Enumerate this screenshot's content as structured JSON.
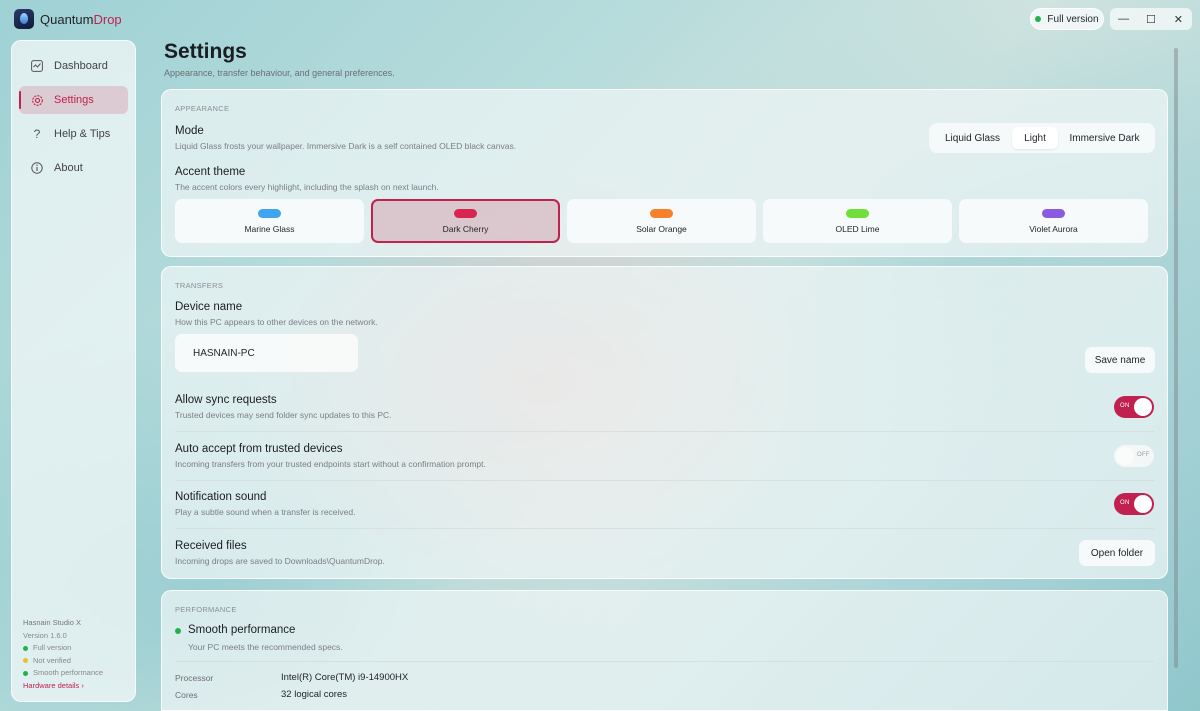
{
  "app": {
    "name_main": "Quantum",
    "name_accent": "Drop",
    "full_version_label": "Full version",
    "window_controls": {
      "minimize": "—",
      "maximize": "☐",
      "close": "✕"
    }
  },
  "sidebar": {
    "items": [
      {
        "label": "Dashboard",
        "icon": "dashboard-icon"
      },
      {
        "label": "Settings",
        "icon": "gear-icon",
        "active": true
      },
      {
        "label": "Help & Tips",
        "icon": "question-icon"
      },
      {
        "label": "About",
        "icon": "info-icon"
      }
    ],
    "footer": {
      "studio": "Hasnain Studio X",
      "version": "Version 1.6.0",
      "status": [
        {
          "label": "Full version",
          "color": "#22b24c"
        },
        {
          "label": "Not verified",
          "color": "#e8c12a"
        },
        {
          "label": "Smooth performance",
          "color": "#22b24c"
        }
      ],
      "hardware_link": "Hardware details ›"
    }
  },
  "page": {
    "title": "Settings",
    "subtitle": "Appearance, transfer behaviour, and general preferences."
  },
  "appearance": {
    "section": "APPEARANCE",
    "mode_title": "Mode",
    "mode_desc": "Liquid Glass frosts your wallpaper. Immersive Dark is a self contained OLED black canvas.",
    "mode_options": [
      "Liquid Glass",
      "Light",
      "Immersive Dark"
    ],
    "mode_selected": "Light",
    "accent_title": "Accent theme",
    "accent_desc": "The accent colors every highlight, including the splash on next launch.",
    "accents": [
      {
        "label": "Marine Glass",
        "color": "#3fa5f0"
      },
      {
        "label": "Dark Cherry",
        "color": "#d8254f",
        "active": true
      },
      {
        "label": "Solar Orange",
        "color": "#f5822a"
      },
      {
        "label": "OLED Lime",
        "color": "#6fe03a"
      },
      {
        "label": "Violet Aurora",
        "color": "#8a5ae0"
      }
    ]
  },
  "transfers": {
    "section": "TRANSFERS",
    "device_title": "Device name",
    "device_desc": "How this PC appears to other devices on the network.",
    "device_value": "HASNAIN-PC",
    "save_label": "Save name",
    "sync_title": "Allow sync requests",
    "sync_desc": "Trusted devices may send folder sync updates to this PC.",
    "sync_state": "ON",
    "auto_title": "Auto accept from trusted devices",
    "auto_desc": "Incoming transfers from your trusted endpoints start without a confirmation prompt.",
    "auto_state": "OFF",
    "notif_title": "Notification sound",
    "notif_desc": "Play a subtle sound when a transfer is received.",
    "notif_state": "ON",
    "received_title": "Received files",
    "received_desc": "Incoming drops are saved to Downloads\\QuantumDrop.",
    "open_folder_label": "Open folder"
  },
  "performance": {
    "section": "PERFORMANCE",
    "status_title": "Smooth performance",
    "status_desc": "Your PC meets the recommended specs.",
    "status_color": "#22b24c",
    "specs": [
      {
        "key": "Processor",
        "value": "Intel(R) Core(TM) i9-14900HX"
      },
      {
        "key": "Cores",
        "value": "32 logical cores"
      }
    ]
  }
}
